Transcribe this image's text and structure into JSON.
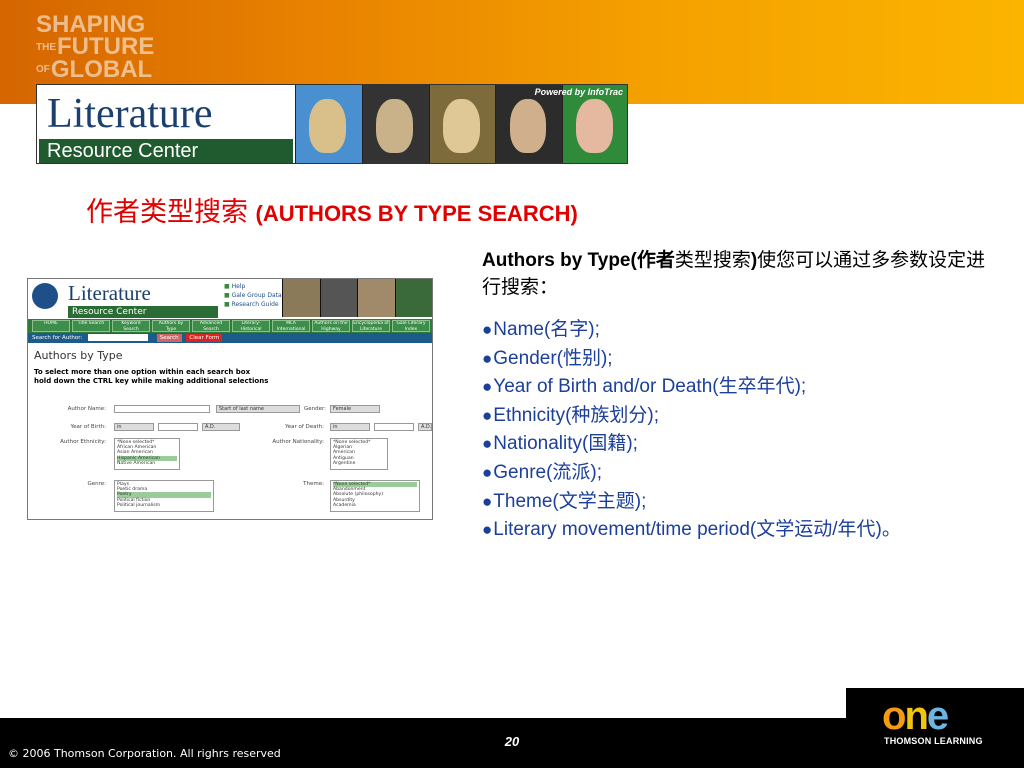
{
  "header": {
    "line1": "SHAPING",
    "line2_small": "THE",
    "line2": "FUTURE",
    "line3_small": "OF",
    "line3": "GLOBAL"
  },
  "banner": {
    "title": "Literature",
    "subtitle": "Resource Center",
    "powered": "Powered by InfoTrac"
  },
  "slide_title": {
    "zh": "作者类型搜索",
    "en": "(AUTHORS BY TYPE SEARCH)"
  },
  "thumbnail": {
    "title": "Literature",
    "subtitle": "Resource Center",
    "links": [
      "Help",
      "Gale Group Databases",
      "Research Guide"
    ],
    "nav": [
      "HOME",
      "Title Search",
      "Keyword Search",
      "Authors by Type",
      "Advanced Search",
      "Literary-Historical Timeline",
      "MLA International Bibliography",
      "Authors on the Highway",
      "Encyclopedia of Literature",
      "Gale Literary Index"
    ],
    "search_label": "Search for Author:",
    "search_button": "Search",
    "clear_button": "Clear Form",
    "heading": "Authors by Type",
    "instruction1": "To select more than one option within each search box",
    "instruction2": "hold down the CTRL key while making additional selections",
    "author_name_label": "Author Name:",
    "author_name_select": "Start of last name",
    "gender_label": "Gender:",
    "gender_value": "Female",
    "birth_label": "Year of Birth:",
    "birth_value": "in",
    "birth_era": "A.D.",
    "death_label": "Year of Death:",
    "death_value": "in",
    "death_era": "A.D.",
    "ethnicity_label": "Author Ethnicity:",
    "ethnicity_options": [
      "*None selected*",
      "African American",
      "Asian American",
      "Hispanic American",
      "Native American"
    ],
    "nationality_label": "Author Nationality:",
    "nationality_options": [
      "*None selected*",
      "Algerian",
      "American",
      "Antiguan",
      "Argentine"
    ],
    "genre_label": "Genre:",
    "genre_options": [
      "Plays",
      "Poetic drama",
      "Poetry",
      "Political fiction",
      "Political journalism"
    ],
    "theme_label": "Theme:",
    "theme_options": [
      "*None selected*",
      "Abandonment",
      "Absolute (philosophy)",
      "Absurdity",
      "Academia"
    ]
  },
  "right": {
    "intro_bold": "Authors by Type(作者",
    "intro_rest1": "类型搜索",
    "intro_bold2": ")",
    "intro_rest2": "使您可以通过多参数设定进行搜索：",
    "bullets": [
      "Name(名字);",
      "Gender(性别);",
      "Year of Birth and/or Death(生卒年代);",
      "Ethnicity(种族划分);",
      "Nationality(国籍);",
      "Genre(流派);",
      "Theme(文学主题);",
      "Literary movement/time period(文学运动/年代)。"
    ]
  },
  "footer": {
    "page": "20",
    "copyright": "© 2006 Thomson Corporation. All righrs reserved",
    "logo_o": "o",
    "logo_n": "n",
    "logo_e": "e",
    "logo_sub": "THOMSON LEARNING"
  }
}
